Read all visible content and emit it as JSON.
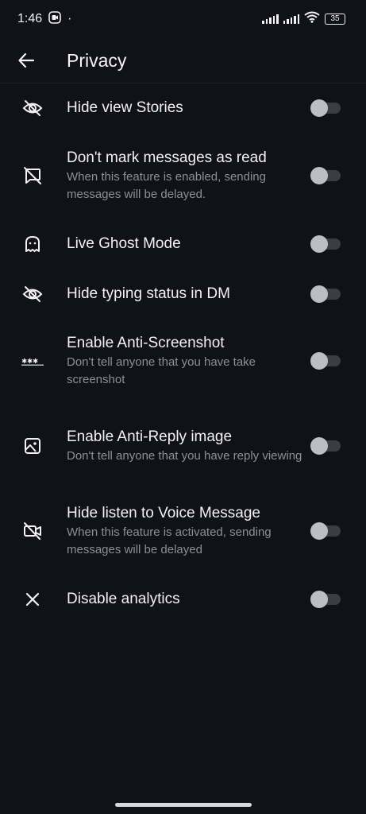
{
  "status_bar": {
    "time": "1:46",
    "dot": "·",
    "battery": "35",
    "icons": [
      "camera-record-icon",
      "signal-icon",
      "signal-icon",
      "wifi-icon",
      "battery-icon"
    ]
  },
  "header": {
    "back_icon": "arrow-left-icon",
    "title": "Privacy"
  },
  "settings": [
    {
      "icon": "eye-off-icon",
      "label": "Hide view Stories",
      "description": "",
      "enabled": false
    },
    {
      "icon": "message-off-icon",
      "label": "Don't mark messages as read",
      "description": "When this feature is enabled, sending messages will be delayed.",
      "enabled": false
    },
    {
      "icon": "ghost-icon",
      "label": "Live Ghost Mode",
      "description": "",
      "enabled": false
    },
    {
      "icon": "eye-off-icon",
      "label": "Hide typing status in DM",
      "description": "",
      "enabled": false
    },
    {
      "icon": "password-dots-icon",
      "label": "Enable Anti-Screenshot",
      "description": "Don't tell anyone that you have take screenshot",
      "enabled": false
    },
    {
      "icon": "image-icon",
      "label": "Enable Anti-Reply image",
      "description": "Don't tell anyone that you have reply viewing",
      "enabled": false
    },
    {
      "icon": "video-off-icon",
      "label": "Hide listen to Voice Message",
      "description": "When this feature is activated, sending messages will be delayed",
      "enabled": false
    },
    {
      "icon": "close-icon",
      "label": "Disable analytics",
      "description": "",
      "enabled": false
    }
  ]
}
